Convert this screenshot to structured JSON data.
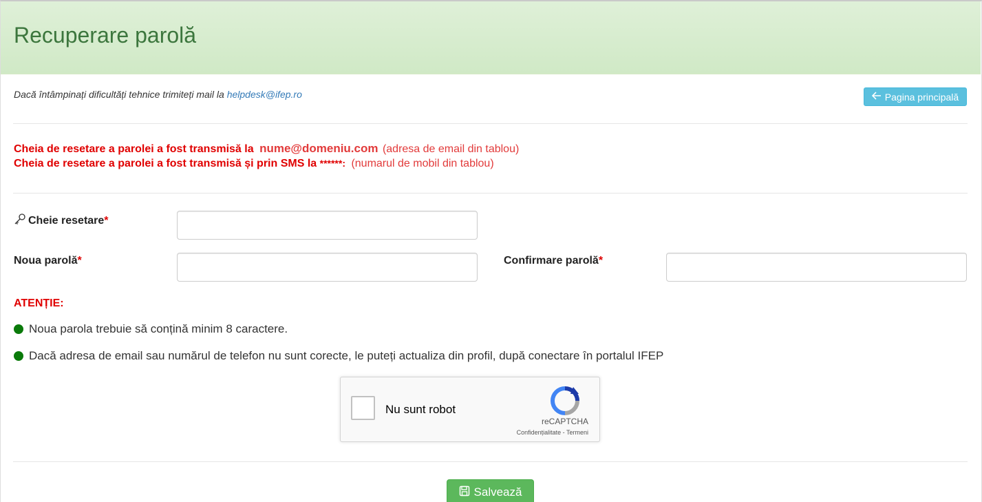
{
  "header": {
    "title": "Recuperare parolă"
  },
  "help": {
    "text": "Dacă întâmpinați dificultăți tehnice trimiteți mail la ",
    "email": "helpdesk@ifep.ro"
  },
  "home_button": {
    "label": "Pagina principală"
  },
  "notice": {
    "line1_prefix": "Cheia de resetare a parolei a fost transmisă la",
    "line1_email": "nume@domeniu.com",
    "line1_note": "(adresa de email din tablou)",
    "line2_prefix": "Cheia de resetare a parolei a fost transmisă și prin SMS la",
    "line2_masked": "******:",
    "line2_note": "(numarul de mobil din tablou)"
  },
  "form": {
    "reset_key_label": "Cheie resetare",
    "new_password_label": "Noua parolă",
    "confirm_password_label": "Confirmare parolă",
    "required_mark": "*"
  },
  "attention": {
    "title": "ATENȚIE:",
    "items": [
      "Noua parola trebuie să conțină minim 8 caractere.",
      "Dacă adresa de email sau numărul de telefon nu sunt corecte, le puteți actualiza din profil, după conectare în portalul IFEP"
    ]
  },
  "captcha": {
    "label": "Nu sunt robot",
    "brand": "reCAPTCHA",
    "links": "Confidențialitate - Termeni"
  },
  "save_button": {
    "label": "Salvează"
  },
  "colors": {
    "header_bg": "#dff0d8",
    "header_text": "#3c763d",
    "alert_red": "#e00000",
    "info_btn": "#5bc0de",
    "success_btn": "#5cb85c",
    "bullet_green": "#0a7a0a"
  },
  "icons": {
    "home_button": "arrow-left-icon",
    "reset_key": "key-icon",
    "save_button": "floppy-disk-icon",
    "bullets": "green-dot-icon"
  }
}
